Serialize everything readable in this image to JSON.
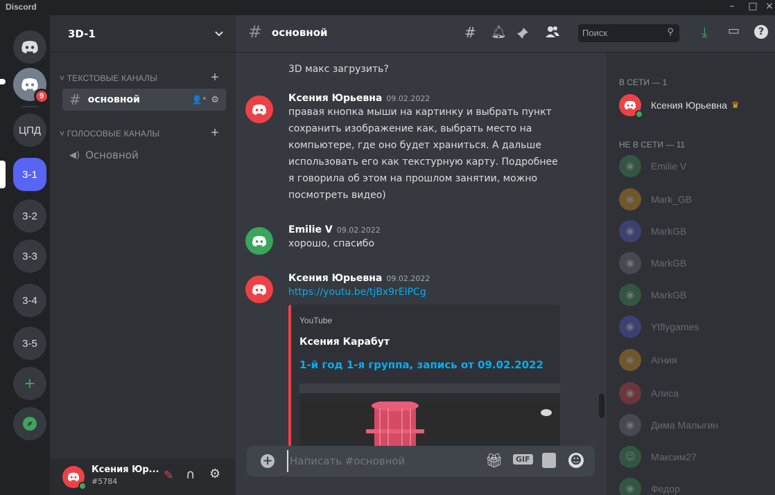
{
  "titlebar": {
    "brand": "Discord",
    "minimize": "–",
    "maximize": "□",
    "close": "×"
  },
  "servers": [
    {
      "label": "",
      "kind": "home"
    },
    {
      "label": "",
      "kind": "server",
      "badge": "9"
    },
    {
      "label": "ЦПД"
    },
    {
      "label": "3-1",
      "active": true
    },
    {
      "label": "3-2"
    },
    {
      "label": "3-3"
    },
    {
      "label": "3-4"
    },
    {
      "label": "3-5"
    }
  ],
  "add_server": "+",
  "server": {
    "name": "3D-1"
  },
  "categories": {
    "text": "ТЕКСТОВЫЕ КАНАЛЫ",
    "voice": "ГОЛОСОВЫЕ КАНАЛЫ"
  },
  "text_channel": "основной",
  "voice_channel": "Основной",
  "user": {
    "name": "Ксения Юр...",
    "tag": "#5784"
  },
  "header": {
    "channel": "основной",
    "search_placeholder": "Поиск"
  },
  "messages": {
    "prev_tail": "3D макс загрузить?",
    "m1": {
      "author": "Ксения Юрьевна",
      "date": "09.02.2022",
      "text": "правая кнопка мыши на картинку и выбрать пункт сохранить изображение как, выбрать место на компьютере, где оно будет храниться. А дальше использовать его как текстурную карту. Подробнее я говорила об этом на прошлом занятии, можно посмотреть видео)"
    },
    "m2": {
      "author": "Emilie V",
      "date": "09.02.2022",
      "text": "хорошо, спасибо"
    },
    "m3": {
      "author": "Ксения Юрьевна",
      "date": "09.02.2022",
      "link": "https://youtu.be/tjBx9rElPCg"
    }
  },
  "embed": {
    "provider": "YouTube",
    "author": "Ксения Карабут",
    "title": "1-й год 1-я группа, запись от 09.02.2022"
  },
  "composer": {
    "placeholder": "Написать #основной",
    "gif": "GIF"
  },
  "members": {
    "online_header": "В СЕТИ — 1",
    "online": [
      {
        "name": "Ксения Юрьевна",
        "color": "#ed4245"
      }
    ],
    "offline_header": "НЕ В СЕТИ — 11",
    "offline": [
      {
        "name": "Emilie V",
        "color": "#3ba55d"
      },
      {
        "name": "Mark_GB",
        "color": "#faa81a"
      },
      {
        "name": "MarkGB",
        "color": "#5865f2"
      },
      {
        "name": "MarkGB",
        "color": "#747f8d"
      },
      {
        "name": "MarkGB",
        "color": "#3ba55d"
      },
      {
        "name": "Ytflygames",
        "color": "#5865f2"
      },
      {
        "name": "Агния",
        "color": "#faa81a"
      },
      {
        "name": "Алиса",
        "color": "#ed4245"
      },
      {
        "name": "Дима Малыгин",
        "color": "#747f8d"
      },
      {
        "name": "Максим27",
        "color": "#3ba55d"
      },
      {
        "name": "Федор",
        "color": "#3ba55d"
      }
    ]
  },
  "colors": {
    "blurple": "#5865f2",
    "red": "#ed4245",
    "green": "#3ba55d",
    "link": "#00aff4",
    "embed_title": "#00aff4"
  }
}
